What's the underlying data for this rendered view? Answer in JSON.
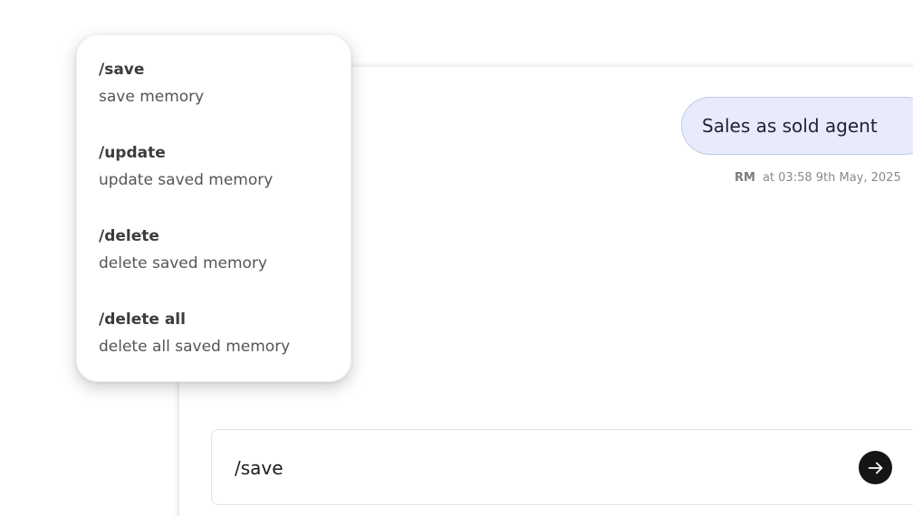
{
  "chat": {
    "message": {
      "text": "Sales as sold agent",
      "sender": "RM",
      "timestamp": "at 03:58 9th May, 2025"
    }
  },
  "composer": {
    "value": "/save",
    "send_icon": "arrow-right-icon"
  },
  "command_menu": {
    "items": [
      {
        "name": "/save",
        "description": "save memory"
      },
      {
        "name": "/update",
        "description": "update saved memory"
      },
      {
        "name": "/delete",
        "description": "delete saved memory"
      },
      {
        "name": "/delete all",
        "description": "delete all saved memory"
      }
    ]
  },
  "colors": {
    "bubble_bg": "#e8ebfb",
    "bubble_border": "#c3c9e9",
    "send_button": "#151515"
  }
}
